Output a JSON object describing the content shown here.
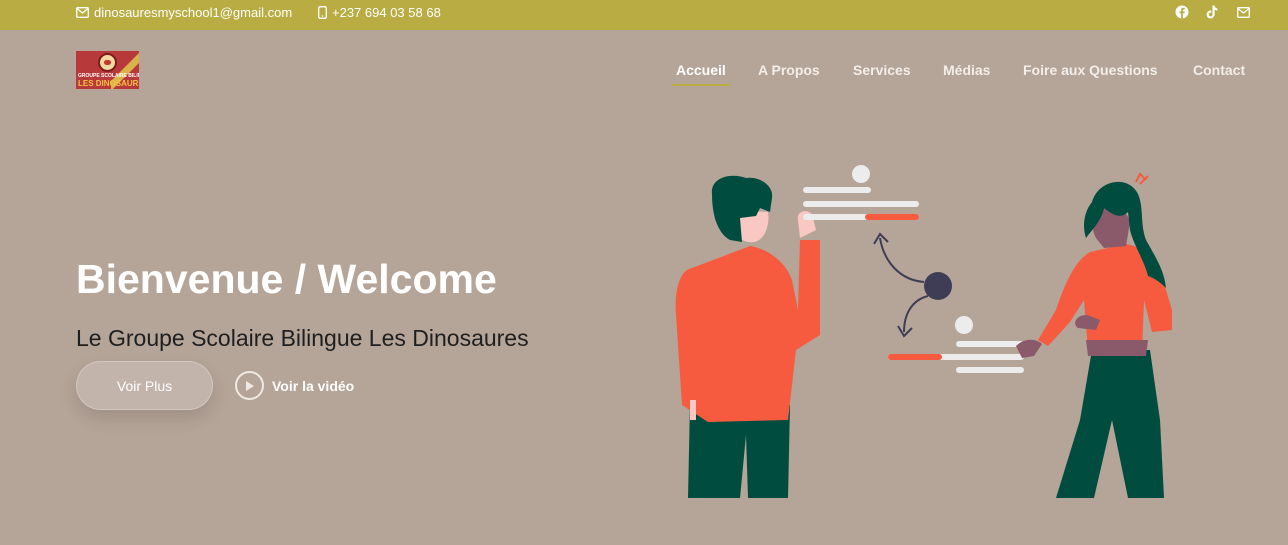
{
  "topbar": {
    "email": "dinosauresmyschool1@gmail.com",
    "phone": "+237 694 03 58 68",
    "social": [
      {
        "icon": "facebook-icon"
      },
      {
        "icon": "tiktok-icon"
      },
      {
        "icon": "mail-icon"
      }
    ],
    "color": "#b8ac42"
  },
  "logo": {
    "line1": "GROUPE SCOLAIRE BILINGUE",
    "line2": "LES DINOSAURES"
  },
  "nav": {
    "items": [
      {
        "label": "Accueil",
        "active": true
      },
      {
        "label": "A Propos",
        "active": false
      },
      {
        "label": "Services",
        "active": false
      },
      {
        "label": "Médias",
        "active": false
      },
      {
        "label": "Foire aux Questions",
        "active": false
      },
      {
        "label": "Contact",
        "active": false
      }
    ]
  },
  "hero": {
    "title": "Bienvenue / Welcome",
    "subtitle": "Le Groupe Scolaire Bilingue Les Dinosaures",
    "more_button": "Voir Plus",
    "video_button": "Voir la vidéo",
    "background": "#b5a498"
  },
  "colors": {
    "accent_orange": "#f65b3f",
    "dark_green": "#004d40",
    "dark_navy": "#3f3d56"
  }
}
